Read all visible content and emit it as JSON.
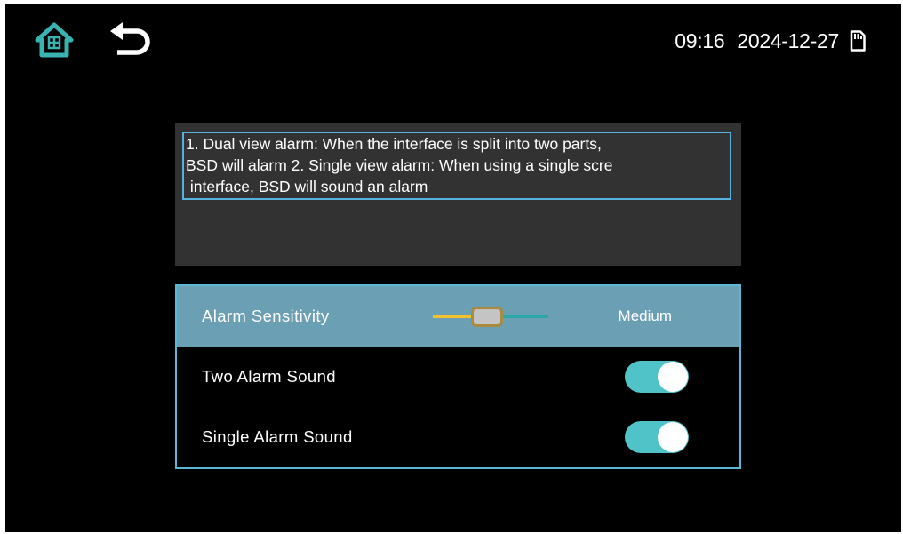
{
  "status": {
    "time": "09:16",
    "date": "2024-12-27"
  },
  "icons": {
    "home": "home-icon",
    "back": "back-arrow-icon",
    "sd_card": "sd-card-icon"
  },
  "help": {
    "lines": [
      "1. Dual view alarm: When the interface is split into two parts,",
      "BSD will alarm  2. Single view alarm: When using a single scre",
      " interface, BSD will sound an alarm"
    ]
  },
  "settings": {
    "alarm_sensitivity": {
      "label": "Alarm Sensitivity",
      "value": "Medium",
      "level": 0.4
    },
    "two_alarm_sound": {
      "label": "Two Alarm Sound",
      "enabled": true
    },
    "single_alarm_sound": {
      "label": "Single Alarm Sound",
      "enabled": true
    }
  },
  "colors": {
    "accent_teal": "#4fc3c7",
    "selected_row": "#6a9fb4",
    "panel_border": "#5cb7d6",
    "slider_active": "#f2c12e",
    "slider_thumb_border": "#a98a3e",
    "home_icon": "#39b3b1"
  }
}
